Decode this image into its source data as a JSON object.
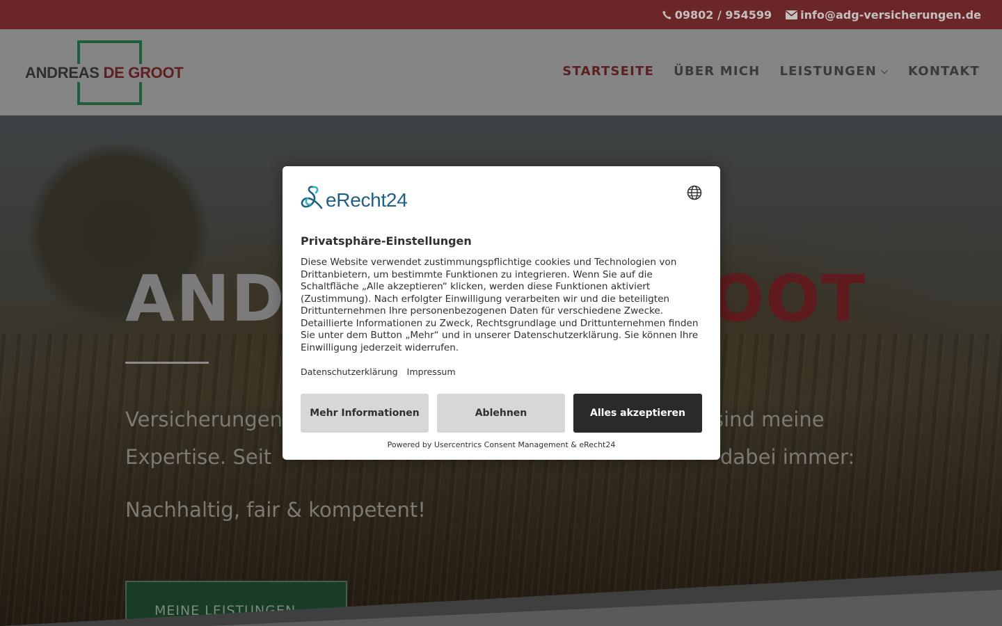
{
  "topbar": {
    "phone": "09802 / 954599",
    "email": "info@adg-versicherungen.de",
    "phone_icon": "phone-icon",
    "email_icon": "envelope-icon",
    "background": "#6b2628"
  },
  "header": {
    "logo": {
      "text_part1": "ANDREAS",
      "text_part2": "DE GROOT"
    },
    "nav": [
      {
        "label": "STARTSEITE",
        "active": true
      },
      {
        "label": "ÜBER MICH"
      },
      {
        "label": "LEISTUNGEN",
        "has_dropdown": true
      },
      {
        "label": "KONTAKT"
      }
    ],
    "accent": "#9e2a2f"
  },
  "hero": {
    "title_left": "AND",
    "title_right": "OOT",
    "lead_line1_left": "Versicherungen",
    "lead_line1_right": "sind meine",
    "lead_line2_left": "Expertise. Seit",
    "lead_line2_right": "dabei immer:",
    "motto": "Nachhaltig, fair & kompetent!",
    "cta": "MEINE LEISTUNGEN..."
  },
  "consent": {
    "brand": "eRecht24",
    "language_icon": "globe-icon",
    "title": "Privatsphäre-Einstellungen",
    "body": "Diese Website verwendet zustimmungspflichtige cookies und Technologien von Drittanbietern, um bestimmte Funktionen zu integrieren. Wenn Sie auf die Schaltfläche „Alle akzeptieren“ klicken, werden diese Funktionen aktiviert (Zustimmung). Nach erfolgter Einwilligung verarbeiten wir und die beteiligten Drittunternehmen Ihre personenbezogenen Daten für verschiedene Zwecke. Detaillierte Informationen zu Zweck, Rechtsgrundlage und Drittunternehmen finden Sie unter dem Button „Mehr“ und in unserer Datenschutzerklärung. Sie können Ihre Einwilligung jederzeit widerrufen.",
    "links": [
      "Datenschutzerklärung",
      "Impressum"
    ],
    "buttons": {
      "more": "Mehr Informationen",
      "decline": "Ablehnen",
      "accept": "Alles akzeptieren"
    },
    "powered_by": "Powered by Usercentrics Consent Management & eRecht24"
  }
}
